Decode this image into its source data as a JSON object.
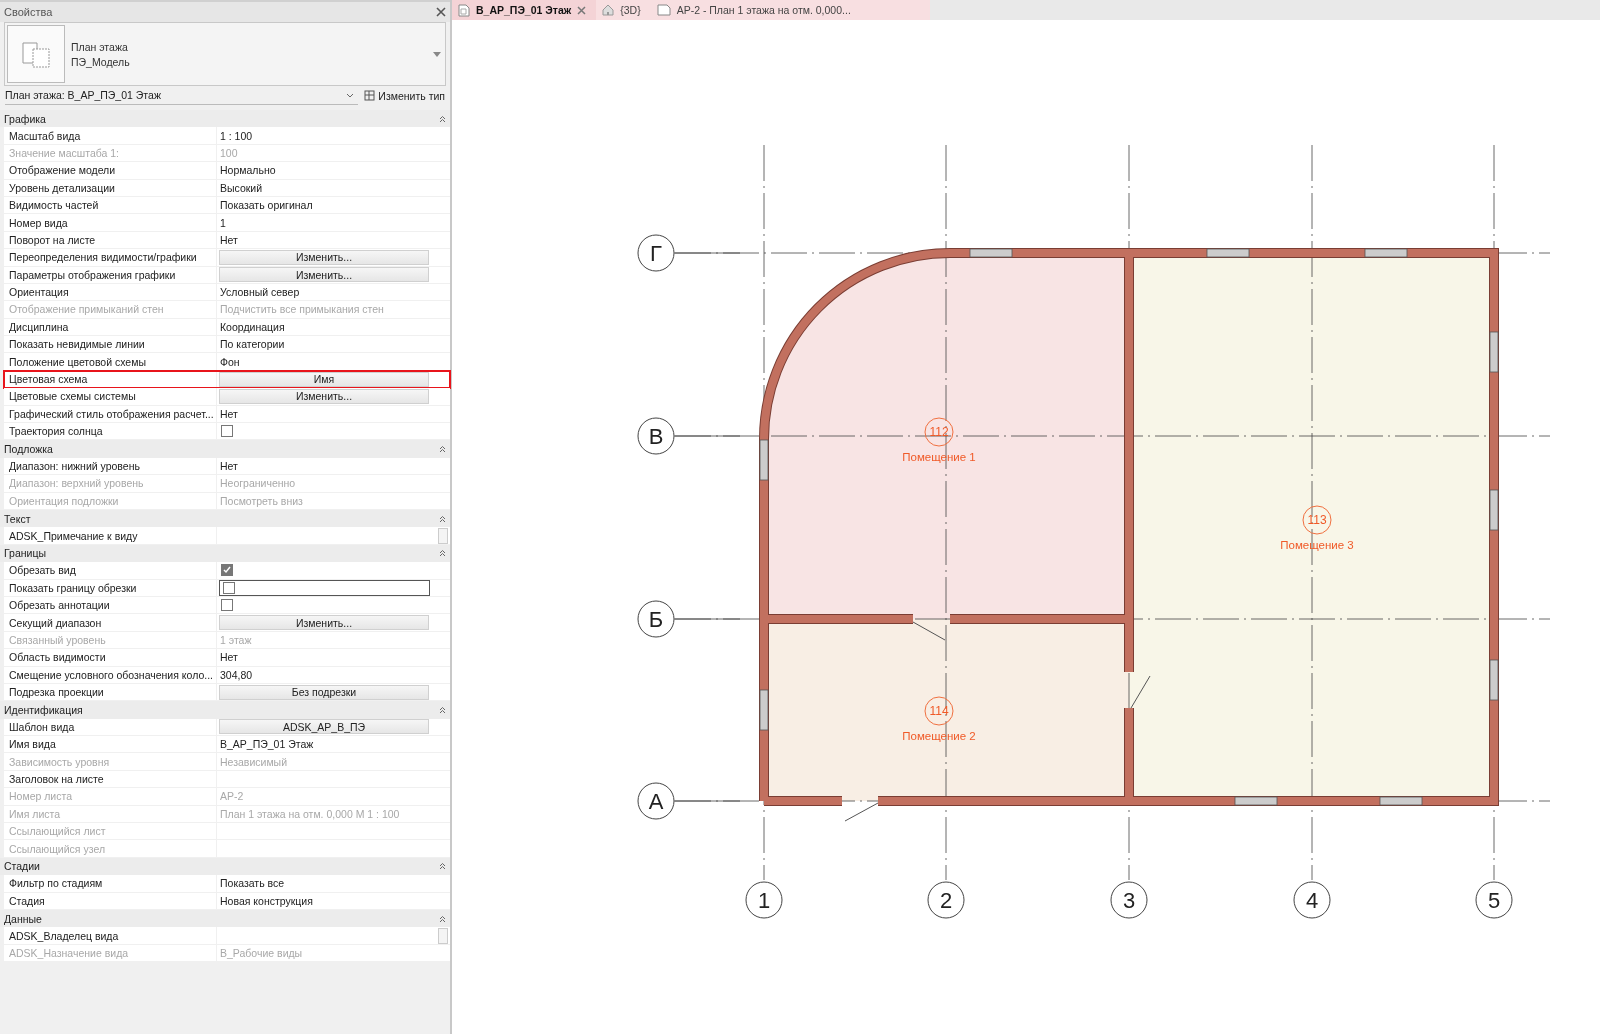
{
  "properties": {
    "title": "Свойства",
    "type_selector": {
      "lines": [
        "План этажа",
        "ПЭ_Модель"
      ]
    },
    "instance_selector": "План этажа: В_АР_ПЭ_01 Этаж",
    "edit_type_button": "Изменить тип",
    "groups": [
      {
        "title": "Графика",
        "rows": [
          {
            "label": "Масштаб вида",
            "value": "1 : 100",
            "kind": "text",
            "disabled": false,
            "highlighted": false
          },
          {
            "label": "Значение масштаба    1:",
            "value": "100",
            "kind": "text",
            "disabled": true,
            "highlighted": false
          },
          {
            "label": "Отображение модели",
            "value": "Нормально",
            "kind": "text",
            "disabled": false,
            "highlighted": false
          },
          {
            "label": "Уровень детализации",
            "value": "Высокий",
            "kind": "text",
            "disabled": false,
            "highlighted": false
          },
          {
            "label": "Видимость частей",
            "value": "Показать оригинал",
            "kind": "text",
            "disabled": false,
            "highlighted": false
          },
          {
            "label": "Номер вида",
            "value": "1",
            "kind": "text",
            "disabled": false,
            "highlighted": false
          },
          {
            "label": "Поворот на листе",
            "value": "Нет",
            "kind": "text",
            "disabled": false,
            "highlighted": false
          },
          {
            "label": "Переопределения видимости/графики",
            "value": "Изменить...",
            "kind": "button",
            "disabled": false,
            "highlighted": false
          },
          {
            "label": "Параметры отображения графики",
            "value": "Изменить...",
            "kind": "button",
            "disabled": false,
            "highlighted": false
          },
          {
            "label": "Ориентация",
            "value": "Условный север",
            "kind": "text",
            "disabled": false,
            "highlighted": false
          },
          {
            "label": "Отображение примыканий стен",
            "value": "Подчистить все примыкания стен",
            "kind": "text",
            "disabled": true,
            "highlighted": false
          },
          {
            "label": "Дисциплина",
            "value": "Координация",
            "kind": "text",
            "disabled": false,
            "highlighted": false
          },
          {
            "label": "Показать невидимые линии",
            "value": "По категории",
            "kind": "text",
            "disabled": false,
            "highlighted": false
          },
          {
            "label": "Положение цветовой схемы",
            "value": "Фон",
            "kind": "text",
            "disabled": false,
            "highlighted": false
          },
          {
            "label": "Цветовая схема",
            "value": "Имя",
            "kind": "button",
            "disabled": false,
            "highlighted": true
          },
          {
            "label": "Цветовые схемы системы",
            "value": "Изменить...",
            "kind": "button",
            "disabled": false,
            "highlighted": false
          },
          {
            "label": "Графический стиль отображения расчет...",
            "value": "Нет",
            "kind": "text",
            "disabled": false,
            "highlighted": false
          },
          {
            "label": "Траектория солнца",
            "checked": false,
            "kind": "checkbox",
            "disabled": false,
            "highlighted": false
          }
        ]
      },
      {
        "title": "Подложка",
        "rows": [
          {
            "label": "Диапазон: нижний уровень",
            "value": "Нет",
            "kind": "text",
            "disabled": false,
            "highlighted": false
          },
          {
            "label": "Диапазон: верхний уровень",
            "value": "Неограниченно",
            "kind": "text",
            "disabled": true,
            "highlighted": false
          },
          {
            "label": "Ориентация подложки",
            "value": "Посмотреть вниз",
            "kind": "text",
            "disabled": true,
            "highlighted": false
          }
        ]
      },
      {
        "title": "Текст",
        "rows": [
          {
            "label": "ADSK_Примечание к виду",
            "kind": "textarea",
            "disabled": false,
            "highlighted": false
          }
        ]
      },
      {
        "title": "Границы",
        "rows": [
          {
            "label": "Обрезать вид",
            "checked": true,
            "kind": "checkbox",
            "disabled": false,
            "highlighted": false
          },
          {
            "label": "Показать границу обрезки",
            "checked": false,
            "kind": "field-checkbox",
            "disabled": false,
            "highlighted": false
          },
          {
            "label": "Обрезать аннотации",
            "checked": false,
            "kind": "checkbox",
            "disabled": false,
            "highlighted": false
          },
          {
            "label": "Секущий диапазон",
            "value": "Изменить...",
            "kind": "button",
            "disabled": false,
            "highlighted": false
          },
          {
            "label": "Связанный уровень",
            "value": "1 этаж",
            "kind": "text",
            "disabled": true,
            "highlighted": false
          },
          {
            "label": "Область видимости",
            "value": "Нет",
            "kind": "text",
            "disabled": false,
            "highlighted": false
          },
          {
            "label": "Смещение условного обозначения коло...",
            "value": "304,80",
            "kind": "text",
            "disabled": false,
            "highlighted": false
          },
          {
            "label": "Подрезка проекции",
            "value": "Без подрезки",
            "kind": "button",
            "disabled": false,
            "highlighted": false
          }
        ]
      },
      {
        "title": "Идентификация",
        "rows": [
          {
            "label": "Шаблон вида",
            "value": "ADSK_АР_В_ПЭ",
            "kind": "button",
            "disabled": false,
            "highlighted": false
          },
          {
            "label": "Имя вида",
            "value": "В_АР_ПЭ_01 Этаж",
            "kind": "text",
            "disabled": false,
            "highlighted": false
          },
          {
            "label": "Зависимость уровня",
            "value": "Независимый",
            "kind": "text",
            "disabled": true,
            "highlighted": false
          },
          {
            "label": "Заголовок на листе",
            "kind": "empty",
            "disabled": false,
            "highlighted": false
          },
          {
            "label": "Номер листа",
            "value": "АР-2",
            "kind": "text",
            "disabled": true,
            "highlighted": false
          },
          {
            "label": "Имя листа",
            "value": "План 1 этажа на отм. 0,000 М 1 : 100",
            "kind": "text",
            "disabled": true,
            "highlighted": false
          },
          {
            "label": "Ссылающийся лист",
            "kind": "empty",
            "disabled": true,
            "highlighted": false
          },
          {
            "label": "Ссылающийся узел",
            "kind": "empty",
            "disabled": true,
            "highlighted": false
          }
        ]
      },
      {
        "title": "Стадии",
        "rows": [
          {
            "label": "Фильтр по стадиям",
            "value": "Показать все",
            "kind": "text",
            "disabled": false,
            "highlighted": false
          },
          {
            "label": "Стадия",
            "value": "Новая конструкция",
            "kind": "text",
            "disabled": false,
            "highlighted": false
          }
        ]
      },
      {
        "title": "Данные",
        "rows": [
          {
            "label": "ADSK_Владелец вида",
            "kind": "textarea",
            "disabled": false,
            "highlighted": false
          },
          {
            "label": "ADSK_Назначение вида",
            "value": "В_Рабочие виды",
            "kind": "text",
            "disabled": true,
            "highlighted": false
          }
        ]
      }
    ]
  },
  "tabs": [
    {
      "label": "В_АР_ПЭ_01 Этаж",
      "kind": "plan",
      "selected": true,
      "closable": true
    },
    {
      "label": "{3D}",
      "kind": "model",
      "selected": false,
      "closable": false
    },
    {
      "label": "АР-2 - План 1 этажа на отм. 0,000...",
      "kind": "sheet",
      "selected": false,
      "closable": false
    }
  ],
  "plan": {
    "grids_vertical": [
      "1",
      "2",
      "3",
      "4",
      "5"
    ],
    "grids_horizontal": [
      "Г",
      "В",
      "Б",
      "А"
    ],
    "rooms": [
      {
        "number": "112",
        "name": "Помещение 1",
        "color": "#f8e4e4"
      },
      {
        "number": "113",
        "name": "Помещение 3",
        "color": "#f8f6e8"
      },
      {
        "number": "114",
        "name": "Помещение 2",
        "color": "#f8eee4"
      }
    ]
  }
}
